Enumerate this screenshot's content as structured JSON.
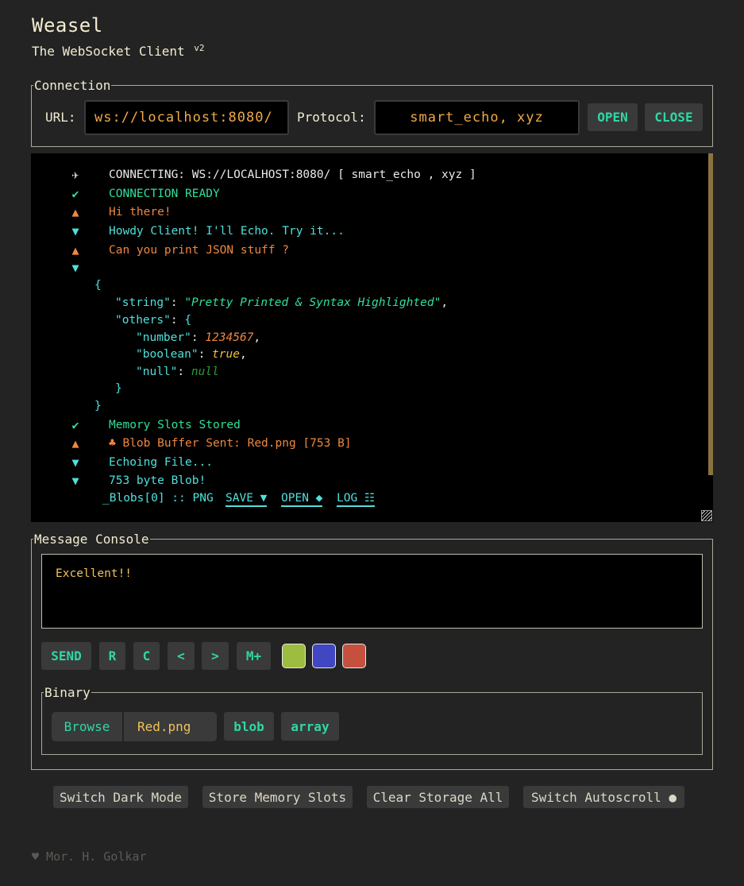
{
  "app": {
    "title": "Weasel",
    "subtitle": "The WebSocket Client",
    "version": "v2"
  },
  "connection": {
    "legend": "Connection",
    "url_label": "URL:",
    "url_value": "ws://localhost:8080/",
    "protocol_label": "Protocol:",
    "protocol_value": "smart_echo, xyz",
    "open_label": "OPEN",
    "close_label": "CLOSE"
  },
  "log": {
    "entries": [
      {
        "icon": "✈",
        "text": "CONNECTING: WS://LOCALHOST:8080/ [ smart_echo , xyz ]"
      },
      {
        "icon": "✔",
        "text": "CONNECTION READY"
      },
      {
        "icon": "▲",
        "text": "Hi there!"
      },
      {
        "icon": "▼",
        "text": "Howdy Client! I'll Echo. Try it..."
      },
      {
        "icon": "▲",
        "text": "Can you print JSON stuff ?"
      },
      {
        "icon": "▼",
        "text": ""
      },
      {
        "icon": "✔",
        "text": "Memory Slots Stored"
      },
      {
        "icon": "▲",
        "text": "♣ Blob Buffer Sent: Red.png [753 B]"
      },
      {
        "icon": "▼",
        "text": "Echoing File..."
      },
      {
        "icon": "▼",
        "text": "753 byte Blob!"
      }
    ],
    "json": {
      "open_brace": "{",
      "string_key": "\"string\"",
      "string_val": "\"Pretty Printed & Syntax Highlighted\"",
      "others_key": "\"others\"",
      "number_key": "\"number\"",
      "number_val": "1234567",
      "boolean_key": "\"boolean\"",
      "boolean_val": "true",
      "null_key": "\"null\"",
      "null_val": "null",
      "inner_close": "}",
      "close_brace": "}"
    },
    "blob_line": {
      "name": "_Blobs[0] :: PNG",
      "save": "SAVE ▼",
      "open": "OPEN ◆",
      "log": "LOG ☷"
    }
  },
  "console": {
    "legend": "Message Console",
    "message": "Excellent!!",
    "buttons": {
      "send": "SEND",
      "r": "R",
      "c": "C",
      "prev": "<",
      "next": ">",
      "mplus": "M+"
    },
    "colors": [
      "#9cbd3f",
      "#4146c2",
      "#c5503e"
    ]
  },
  "binary": {
    "legend": "Binary",
    "browse": "Browse",
    "file": "Red.png",
    "blob": "blob",
    "array": "array"
  },
  "bottom": {
    "dark_mode": "Switch Dark Mode",
    "store": "Store Memory Slots",
    "clear": "Clear Storage All",
    "autoscroll": "Switch Autoscroll ●"
  },
  "footer": "♥ Mor. H. Golkar"
}
